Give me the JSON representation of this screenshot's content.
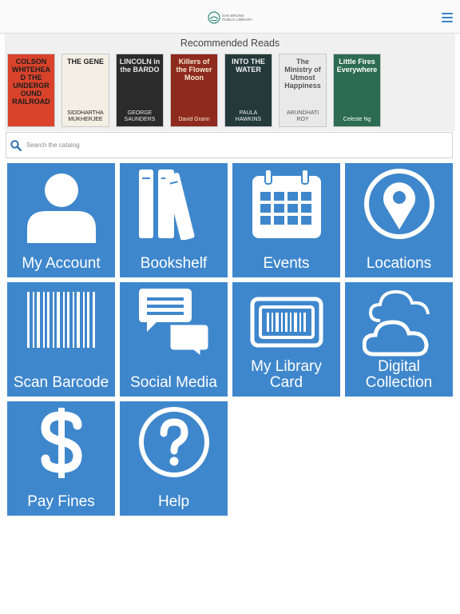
{
  "header": {
    "logo_line1": "SAN BRUNO",
    "logo_line2": "PUBLIC LIBRARY",
    "colors": {
      "accent": "#3a82c8",
      "status": "#3ac25a"
    }
  },
  "recommended": {
    "title": "Recommended Reads",
    "books": [
      {
        "title": "COLSON WHITEHEAD THE UNDERGROUND RAILROAD",
        "author": "",
        "bg": "#d9432b",
        "fg": "#1d1d1d"
      },
      {
        "title": "THE GENE",
        "author": "SIDDHARTHA MUKHERJEE",
        "bg": "#f4efe4",
        "fg": "#222222"
      },
      {
        "title": "LINCOLN in the BARDO",
        "author": "GEORGE SAUNDERS",
        "bg": "#2b2b2b",
        "fg": "#e8e8e8"
      },
      {
        "title": "Killers of the Flower Moon",
        "author": "David Grann",
        "bg": "#8f2a1e",
        "fg": "#f4e9d0"
      },
      {
        "title": "INTO THE WATER",
        "author": "PAULA HAWKINS",
        "bg": "#24393a",
        "fg": "#f2f2f2"
      },
      {
        "title": "The Ministry of Utmost Happiness",
        "author": "ARUNDHATI ROY",
        "bg": "#e9e9e9",
        "fg": "#555555"
      },
      {
        "title": "Little Fires Everywhere",
        "author": "Celeste Ng",
        "bg": "#2d6b52",
        "fg": "#ffffff"
      }
    ]
  },
  "search": {
    "placeholder": "Search the catalog"
  },
  "tiles": [
    {
      "label": "My Account",
      "icon": "user-icon"
    },
    {
      "label": "Bookshelf",
      "icon": "books-icon"
    },
    {
      "label": "Events",
      "icon": "calendar-icon"
    },
    {
      "label": "Locations",
      "icon": "location-pin-icon"
    },
    {
      "label": "Scan Barcode",
      "icon": "barcode-icon"
    },
    {
      "label": "Social Media",
      "icon": "chat-bubbles-icon"
    },
    {
      "label_line1": "My Library",
      "label_line2": "Card",
      "icon": "library-card-icon"
    },
    {
      "label_line1": "Digital",
      "label_line2": "Collection",
      "icon": "cloud-icon"
    },
    {
      "label": "Pay Fines",
      "icon": "dollar-icon"
    },
    {
      "label": "Help",
      "icon": "question-icon"
    }
  ],
  "tile_color": "#3f87cc"
}
